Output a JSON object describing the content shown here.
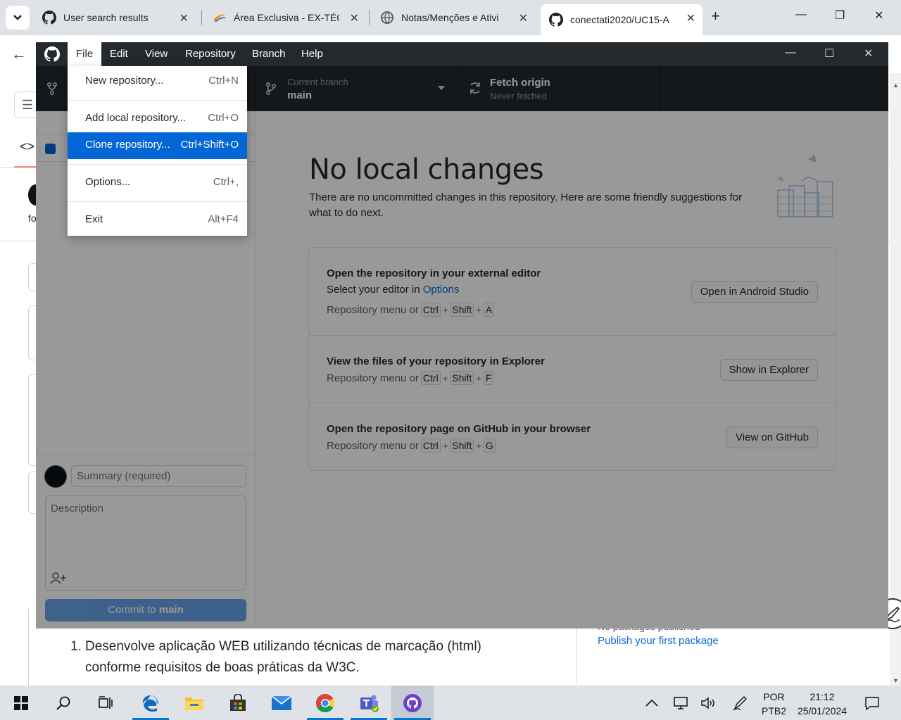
{
  "browser": {
    "tabs": [
      {
        "title": "User search results",
        "icon": "github-icon",
        "active": false
      },
      {
        "title": "Área Exclusiva - EX-TÉC",
        "icon": "orange-swoosh-icon",
        "active": false
      },
      {
        "title": "Notas/Menções e Ativi",
        "icon": "globe-icon",
        "active": false
      },
      {
        "title": "conectati2020/UC15-A",
        "icon": "github-icon",
        "active": true
      }
    ]
  },
  "github_page": {
    "code_tab": "<>",
    "partial_text": "fo",
    "list_number": "1.",
    "list_text": "Desenvolve aplicação WEB utilizando técnicas de marcação (html) conforme requisitos de boas práticas da W3C.",
    "packages_faded": "No packages published",
    "publish_link": "Publish your first package"
  },
  "desktop": {
    "menu": {
      "file": "File",
      "edit": "Edit",
      "view": "View",
      "repository": "Repository",
      "branch": "Branch",
      "help": "Help"
    },
    "toolbar": {
      "branch_label": "Current branch",
      "branch_value": "main",
      "fetch_label": "Fetch origin",
      "fetch_status": "Never fetched"
    },
    "file_menu": [
      {
        "label": "New repository...",
        "shortcut": "Ctrl+N"
      },
      {
        "label": "Add local repository...",
        "shortcut": "Ctrl+O"
      },
      {
        "label": "Clone repository...",
        "shortcut": "Ctrl+Shift+O"
      },
      {
        "label": "Options...",
        "shortcut": "Ctrl+,"
      },
      {
        "label": "Exit",
        "shortcut": "Alt+F4"
      }
    ],
    "commit": {
      "summary_placeholder": "Summary (required)",
      "description_placeholder": "Description",
      "button_prefix": "Commit to ",
      "button_branch": "main"
    },
    "main": {
      "title": "No local changes",
      "subtitle": "There are no uncommitted changes in this repository. Here are some friendly suggestions for what to do next.",
      "menu_prefix": "Repository menu or",
      "suggestions": [
        {
          "title": "Open the repository in your external editor",
          "line_prefix": "Select your editor in ",
          "line_link": "Options",
          "keys": [
            "Ctrl",
            "Shift",
            "A"
          ],
          "button": "Open in Android Studio"
        },
        {
          "title": "View the files of your repository in Explorer",
          "keys": [
            "Ctrl",
            "Shift",
            "F"
          ],
          "button": "Show in Explorer"
        },
        {
          "title": "Open the repository page on GitHub in your browser",
          "keys": [
            "Ctrl",
            "Shift",
            "G"
          ],
          "button": "View on GitHub"
        }
      ]
    }
  },
  "taskbar": {
    "lang_top": "POR",
    "lang_bottom": "PTB2",
    "time": "21:12",
    "date": "25/01/2024"
  },
  "colors": {
    "accent": "#0366d6",
    "titlebar": "#24292e",
    "taskbar_underline": "#0078d4"
  }
}
